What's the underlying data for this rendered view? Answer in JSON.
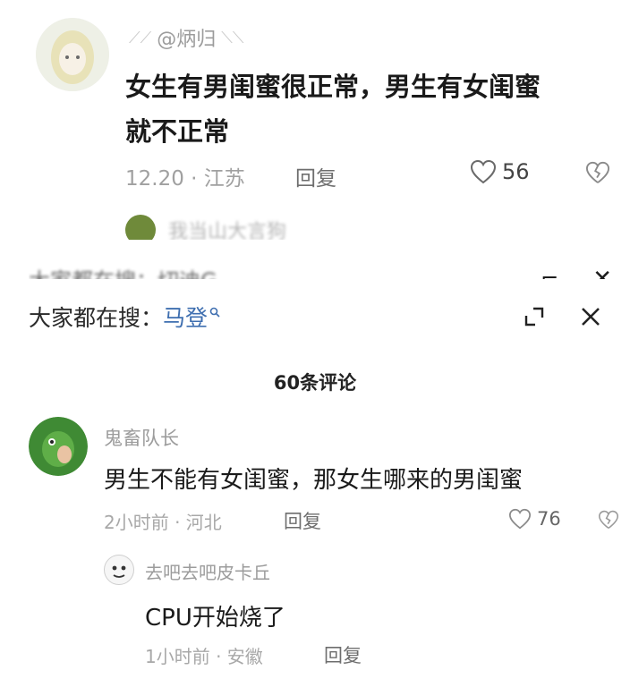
{
  "top_comment": {
    "username": "@炳归",
    "content_line1": "女生有男闺蜜很正常，男生有女闺蜜",
    "content_line2": "就不正常",
    "time_location": "12.20 · 江苏",
    "reply_label": "回复",
    "like_count": "56"
  },
  "cut_reply_name": "我当山大言狗",
  "search_ghost": "大家都在搜：切迪G",
  "search_bar": {
    "prefix": "大家都在搜：",
    "term": "马登"
  },
  "comments_header": "60条评论",
  "comment1": {
    "username": "鬼畜队长",
    "content": "男生不能有女闺蜜，那女生哪来的男闺蜜",
    "time_location": "2小时前 · 河北",
    "reply_label": "回复",
    "like_count": "76"
  },
  "reply1": {
    "username": "去吧去吧皮卡丘",
    "content": "CPU开始烧了",
    "time_location": "1小时前 · 安徽",
    "reply_label": "回复"
  },
  "colors": {
    "search_term": "#3f6fb0",
    "muted_text": "#9a9a9a"
  }
}
